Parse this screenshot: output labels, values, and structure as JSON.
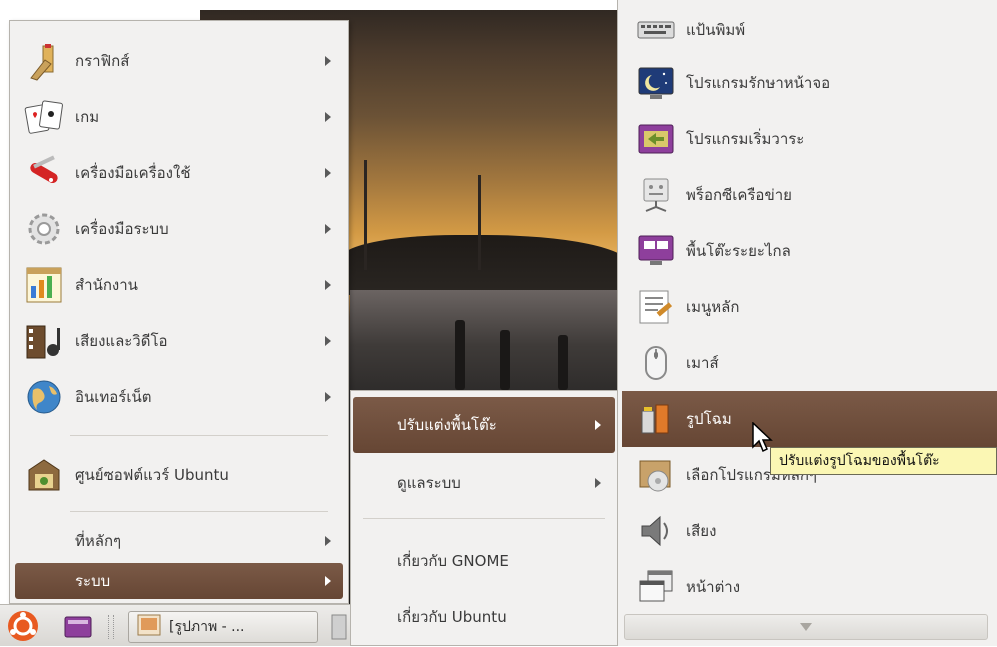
{
  "main_menu": {
    "items": [
      {
        "label": "กราฟิกส์",
        "icon": "graphics-icon",
        "has_submenu": true
      },
      {
        "label": "เกม",
        "icon": "games-icon",
        "has_submenu": true
      },
      {
        "label": "เครื่องมือเครื่องใช้",
        "icon": "accessories-icon",
        "has_submenu": true
      },
      {
        "label": "เครื่องมือระบบ",
        "icon": "system-tools-icon",
        "has_submenu": true
      },
      {
        "label": "สำนักงาน",
        "icon": "office-icon",
        "has_submenu": true
      },
      {
        "label": "เสียงและวิดีโอ",
        "icon": "sound-video-icon",
        "has_submenu": true
      },
      {
        "label": "อินเทอร์เน็ต",
        "icon": "internet-icon",
        "has_submenu": true
      },
      {
        "label": "ศูนย์ซอฟต์แวร์ Ubuntu",
        "icon": "software-center-icon",
        "has_submenu": false
      }
    ],
    "places_label": "ที่หลักๆ",
    "system_label": "ระบบ"
  },
  "system_submenu": {
    "items": [
      {
        "label": "ปรับแต่งพื้นโต๊ะ",
        "has_submenu": true,
        "selected": true
      },
      {
        "label": "ดูแลระบบ",
        "has_submenu": true,
        "selected": false
      },
      {
        "label": "เกี่ยวกับ GNOME",
        "has_submenu": false,
        "selected": false
      },
      {
        "label": "เกี่ยวกับ Ubuntu",
        "has_submenu": false,
        "selected": false
      }
    ]
  },
  "preferences_menu": {
    "items": [
      {
        "label": "แป้นพิมพ์",
        "icon": "keyboard-icon"
      },
      {
        "label": "โปรแกรมรักษาหน้าจอ",
        "icon": "screensaver-icon"
      },
      {
        "label": "โปรแกรมเริ่มวาระ",
        "icon": "startup-applications-icon"
      },
      {
        "label": "พร็อกซีเครือข่าย",
        "icon": "network-proxy-icon"
      },
      {
        "label": "พื้นโต๊ะระยะไกล",
        "icon": "remote-desktop-icon"
      },
      {
        "label": "เมนูหลัก",
        "icon": "main-menu-icon"
      },
      {
        "label": "เมาส์",
        "icon": "mouse-icon"
      },
      {
        "label": "รูปโฉม",
        "icon": "appearance-icon",
        "selected": true
      },
      {
        "label": "เลือกโปรแกรมหลักๆ",
        "icon": "preferred-applications-icon"
      },
      {
        "label": "เสียง",
        "icon": "sound-icon"
      },
      {
        "label": "หน้าต่าง",
        "icon": "windows-icon"
      }
    ]
  },
  "tooltip": "ปรับแต่งรูปโฉมของพื้นโต๊ะ",
  "panel": {
    "task_label": "[รูปภาพ - ..."
  },
  "colors": {
    "selection": "#6f4e3c",
    "menu_bg": "#f2f1f0",
    "tooltip_bg": "#fbf7b4"
  }
}
